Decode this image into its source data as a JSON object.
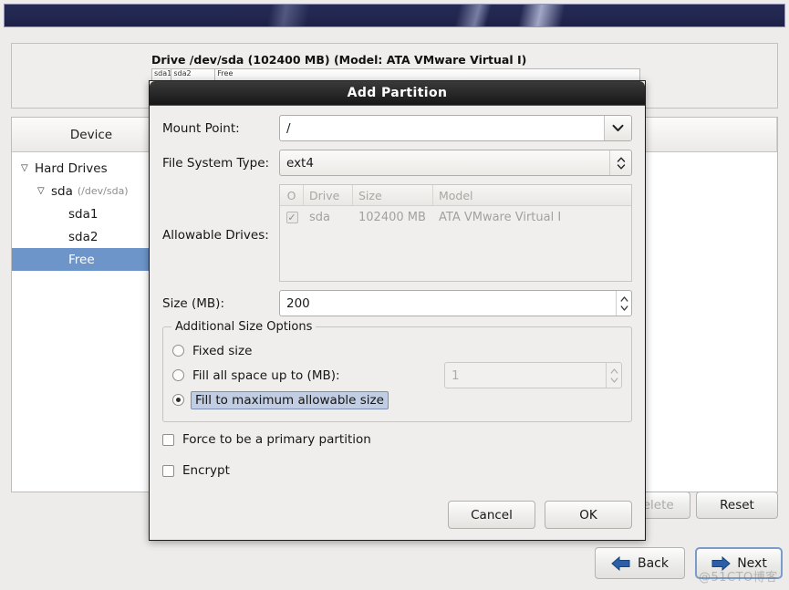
{
  "installer": {
    "drive_label": "Drive /dev/sda (102400 MB) (Model: ATA VMware Virtual I)",
    "partition_segments": [
      {
        "label": "sda1",
        "width_pct": 4
      },
      {
        "label": "sda2",
        "width_pct": 9
      },
      {
        "label": "Free",
        "width_pct": 87
      }
    ],
    "tree_columns": {
      "device": "Device",
      "rest": ""
    },
    "tree_items": [
      {
        "label": "Hard Drives",
        "twisty": "▽",
        "indent": 0,
        "dim": "",
        "selected": false
      },
      {
        "label": "sda",
        "twisty": "▽",
        "indent": 18,
        "dim": "(/dev/sda)",
        "selected": false
      },
      {
        "label": "sda1",
        "twisty": "",
        "indent": 52,
        "dim": "",
        "selected": false
      },
      {
        "label": "sda2",
        "twisty": "",
        "indent": 52,
        "dim": "",
        "selected": false
      },
      {
        "label": "Free",
        "twisty": "",
        "indent": 52,
        "dim": "",
        "selected": true
      }
    ],
    "buttons": {
      "delete": "Delete",
      "reset": "Reset",
      "back": "Back",
      "next": "Next"
    },
    "watermark": "@51CTO博客"
  },
  "dialog": {
    "title": "Add Partition",
    "mount_point": {
      "label": "Mount Point:",
      "value": "/",
      "placeholder": ""
    },
    "file_system_type": {
      "label": "File System Type:",
      "value": "ext4"
    },
    "allowable_drives": {
      "label": "Allowable Drives:",
      "columns": [
        "O",
        "Drive",
        "Size",
        "Model"
      ],
      "rows": [
        {
          "checked": "✓",
          "drive": "sda",
          "size": "102400 MB",
          "model": "ATA VMware Virtual I"
        }
      ]
    },
    "size": {
      "label": "Size (MB):",
      "value": "200"
    },
    "additional_size_options": {
      "legend": "Additional Size Options",
      "options": [
        {
          "label": "Fixed size",
          "selected": false,
          "focused": false
        },
        {
          "label": "Fill all space up to (MB):",
          "selected": false,
          "focused": false,
          "spin_value": "1"
        },
        {
          "label": "Fill to maximum allowable size",
          "selected": true,
          "focused": true
        }
      ]
    },
    "checkboxes": [
      {
        "label": "Force to be a primary partition",
        "checked": false
      },
      {
        "label": "Encrypt",
        "checked": false
      }
    ],
    "buttons": {
      "cancel": "Cancel",
      "ok": "OK"
    }
  },
  "colors": {
    "header_banner": "#222750",
    "selection_blue": "#6d95c9",
    "focus_highlight": "#c1cde2",
    "accent_arrow": "#2b5fa8"
  }
}
